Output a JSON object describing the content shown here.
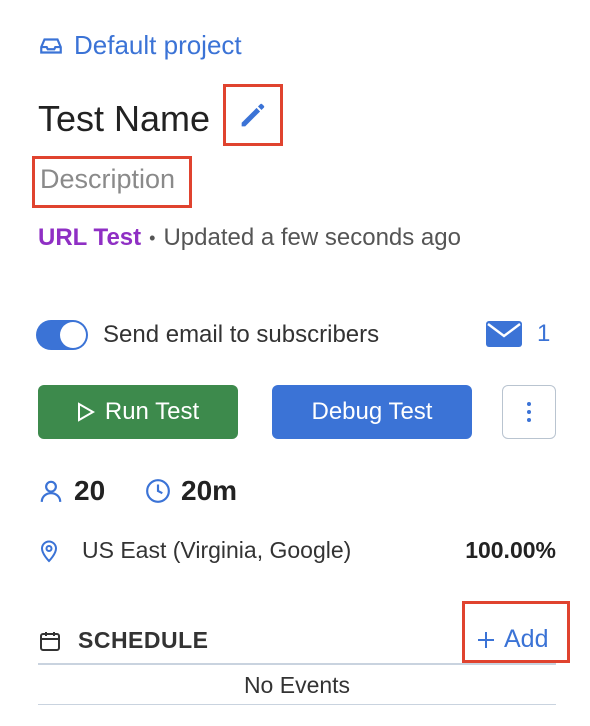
{
  "project": {
    "label": "Default project",
    "icon": "inbox-icon"
  },
  "test": {
    "name": "Test Name",
    "description_placeholder": "Description",
    "type": "URL Test",
    "separator": "•",
    "updated": "Updated a few seconds ago"
  },
  "notifications": {
    "toggle_label": "Send email to subscribers",
    "toggle_on": true,
    "subscriber_count": "1"
  },
  "actions": {
    "run_label": "Run Test",
    "debug_label": "Debug Test"
  },
  "stats": {
    "users": "20",
    "duration": "20m"
  },
  "location": {
    "name": "US East (Virginia, Google)",
    "percent": "100.00%"
  },
  "schedule": {
    "title": "SCHEDULE",
    "add_label": "Add",
    "empty": "No Events"
  },
  "colors": {
    "accent": "#3b73d6",
    "run": "#3d8a4c",
    "type": "#8f2fc4",
    "highlight": "#e0432f"
  }
}
